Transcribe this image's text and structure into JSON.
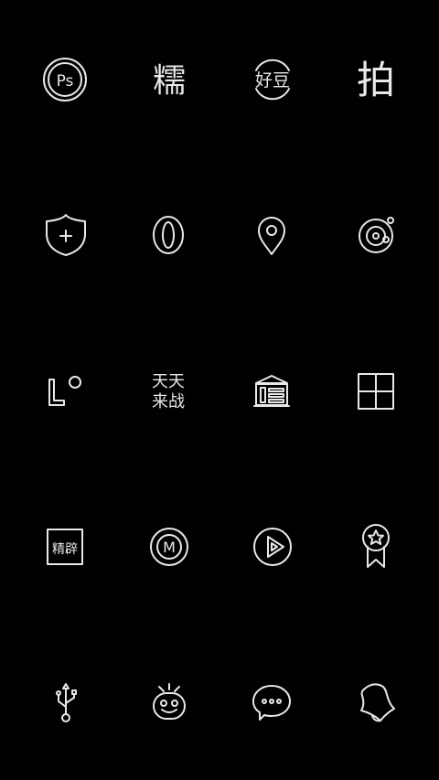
{
  "screen": {
    "background_color": "#000000",
    "icon_color": "#e8e8e8"
  },
  "icons": [
    {
      "name": "photoshop-express-icon",
      "glyph_text": "Ps"
    },
    {
      "name": "nuomi-icon",
      "glyph_text": "糯"
    },
    {
      "name": "haodou-icon",
      "glyph_text": "好豆"
    },
    {
      "name": "pai-camera-icon",
      "glyph_text": "拍"
    },
    {
      "name": "security-shield-icon",
      "glyph_text": "+"
    },
    {
      "name": "oval-zero-icon",
      "glyph_text": ""
    },
    {
      "name": "map-location-pin-icon",
      "glyph_text": ""
    },
    {
      "name": "music-disc-icon",
      "glyph_text": ""
    },
    {
      "name": "letter-l-circle-icon",
      "glyph_text": ""
    },
    {
      "name": "tiantian-laizhan-icon",
      "glyph_text_line1": "天天",
      "glyph_text_line2": "来战"
    },
    {
      "name": "bank-building-icon",
      "glyph_text": ""
    },
    {
      "name": "windows-grid-icon",
      "glyph_text": ""
    },
    {
      "name": "jingci-dictionary-icon",
      "glyph_text": "精辟"
    },
    {
      "name": "m-circle-icon",
      "glyph_text": "M"
    },
    {
      "name": "play-circle-icon",
      "glyph_text": ""
    },
    {
      "name": "award-medal-icon",
      "glyph_text": ""
    },
    {
      "name": "usb-icon",
      "glyph_text": ""
    },
    {
      "name": "robot-face-icon",
      "glyph_text": ""
    },
    {
      "name": "chat-bubble-icon",
      "glyph_text": ""
    },
    {
      "name": "bell-icon",
      "glyph_text": ""
    }
  ]
}
